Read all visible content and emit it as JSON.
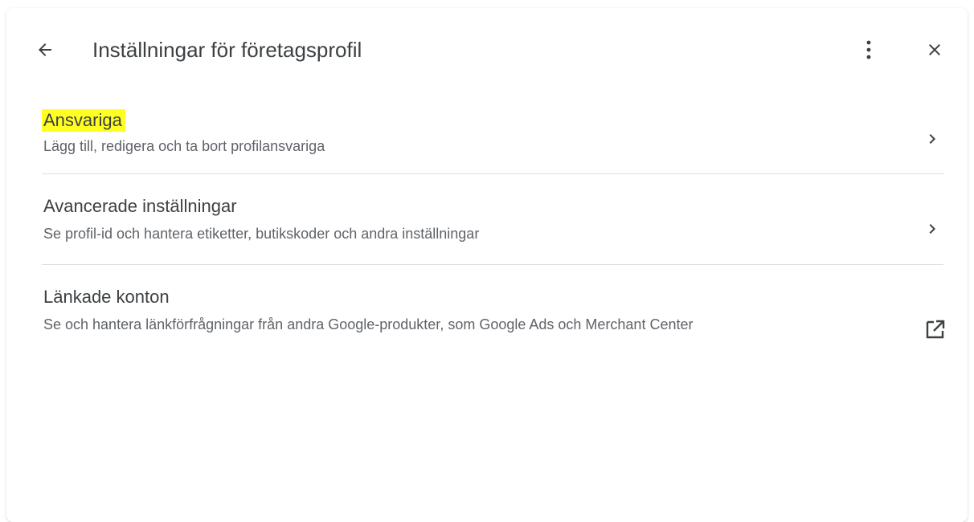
{
  "header": {
    "title": "Inställningar för företagsprofil",
    "back_icon": "arrow-back-icon",
    "more_icon": "more-vert-icon",
    "close_icon": "close-icon"
  },
  "items": [
    {
      "title": "Ansvariga",
      "description": "Lägg till, redigera och ta bort profilansvariga",
      "icon": "chevron-right-icon",
      "highlighted": true
    },
    {
      "title": "Avancerade inställningar",
      "description": "Se profil-id och hantera etiketter, butikskoder och andra inställningar",
      "icon": "chevron-right-icon"
    },
    {
      "title": "Länkade konton",
      "description": "Se och hantera länkförfrågningar från andra Google-produkter, som Google Ads och Merchant Center",
      "icon": "open-in-new-icon"
    }
  ],
  "colors": {
    "highlight": "#ffff22",
    "text_primary": "#3c4043",
    "text_secondary": "#5f6368",
    "divider": "#dadce0"
  }
}
